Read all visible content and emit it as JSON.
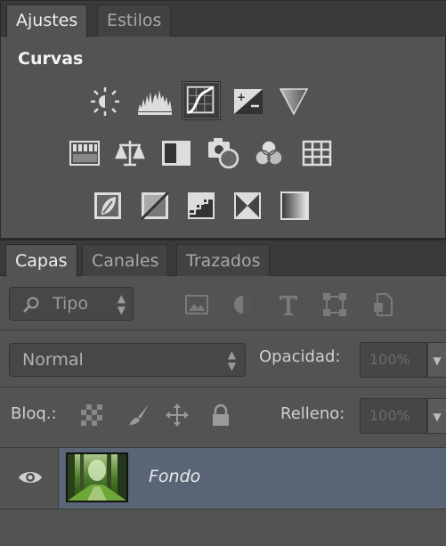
{
  "adjustments_panel": {
    "tabs": [
      {
        "label": "Ajustes",
        "active": true
      },
      {
        "label": "Estilos",
        "active": false
      }
    ],
    "section_title": "Curvas",
    "icons": {
      "row1": [
        "brightness-contrast-icon",
        "levels-icon",
        "curves-icon",
        "exposure-icon",
        "gradient-map-triangle-icon"
      ],
      "row2": [
        "hue-saturation-icon",
        "color-balance-icon",
        "black-white-icon",
        "photo-filter-icon",
        "channel-mixer-icon",
        "color-lookup-icon"
      ],
      "row3": [
        "invert-icon",
        "posterize-icon",
        "threshold-icon",
        "selective-color-icon",
        "gradient-map-icon"
      ]
    },
    "selected_icon": "curves-icon"
  },
  "layers_panel": {
    "tabs": [
      {
        "label": "Capas",
        "active": true
      },
      {
        "label": "Canales",
        "active": false
      },
      {
        "label": "Trazados",
        "active": false
      }
    ],
    "filter": {
      "label": "Tipo",
      "icons": [
        "filter-pixel-icon",
        "filter-adjustment-icon",
        "filter-type-icon",
        "filter-shape-icon",
        "filter-smart-object-icon"
      ]
    },
    "blend_mode": "Normal",
    "opacity_label": "Opacidad:",
    "opacity_value": "100%",
    "lock_label": "Bloq.:",
    "lock_icons": [
      "lock-transparent-icon",
      "lock-image-icon",
      "lock-position-icon",
      "lock-all-icon"
    ],
    "fill_label": "Relleno:",
    "fill_value": "100%",
    "layers": [
      {
        "name": "Fondo",
        "visible": true,
        "selected": true
      }
    ]
  },
  "colors": {
    "panel_bg": "#535353",
    "tab_bar_bg": "#3a3a3a",
    "selected_layer_bg": "#596475"
  }
}
